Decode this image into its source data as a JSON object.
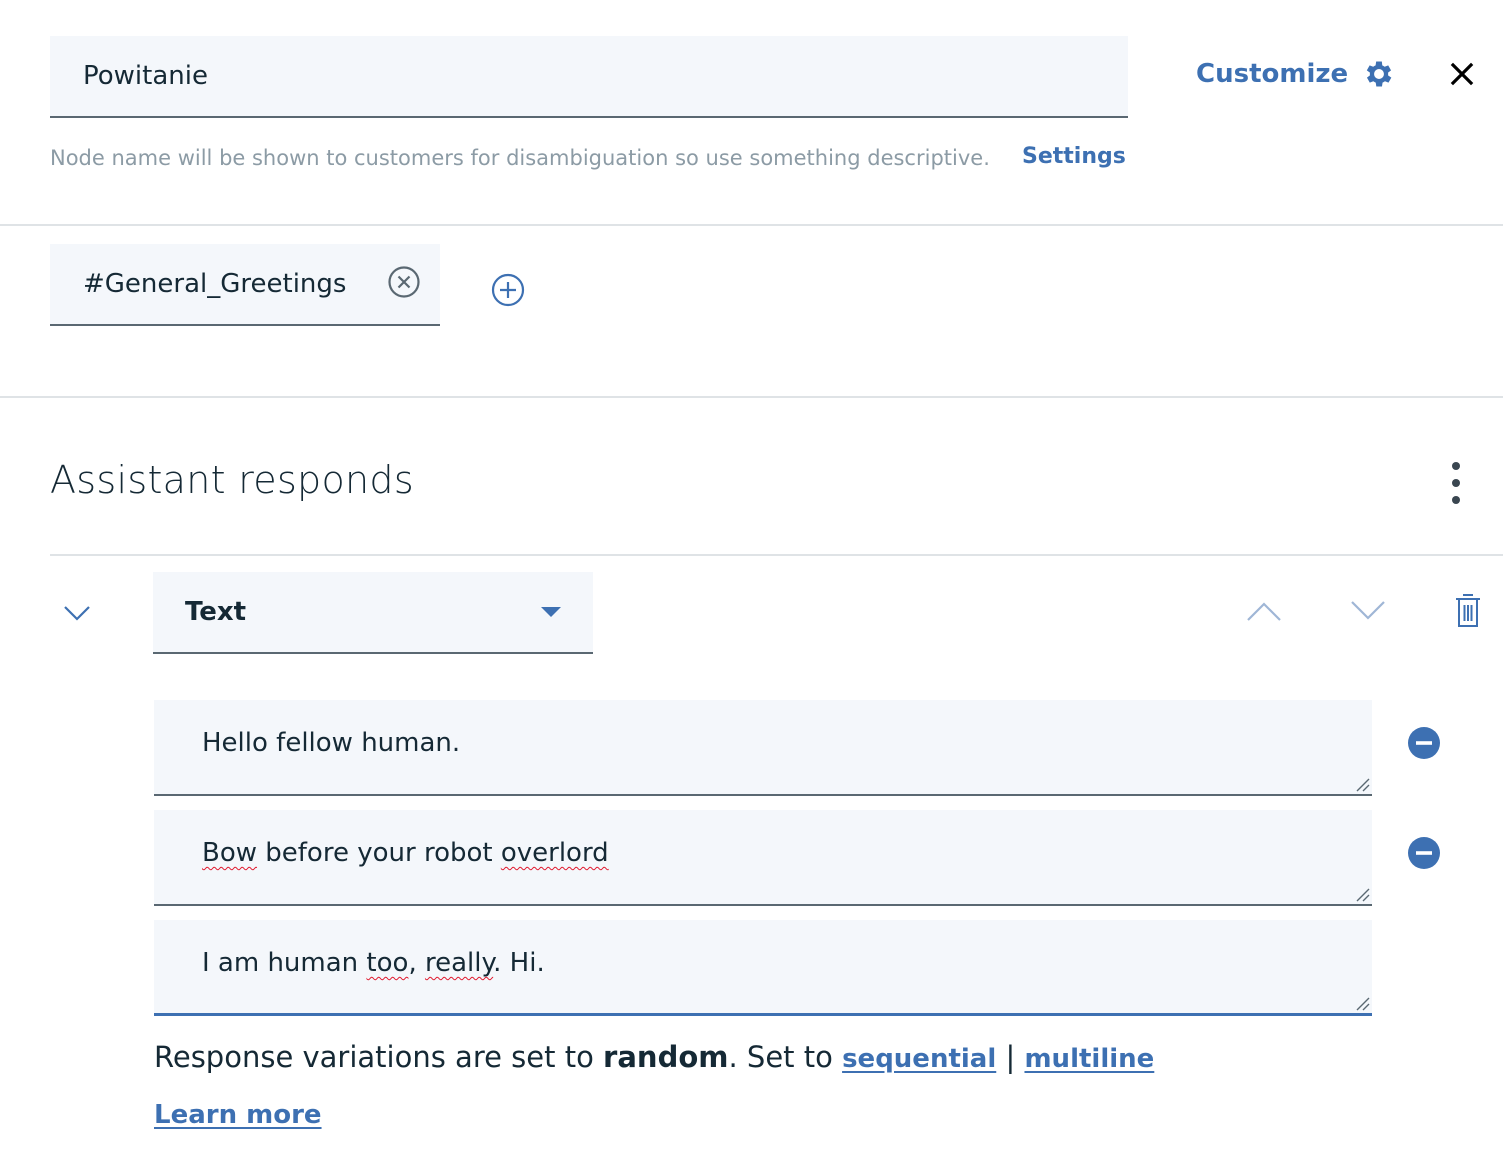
{
  "node": {
    "name_value": "Powitanie",
    "hint": "Node name will be shown to customers for disambiguation so use something descriptive.",
    "settings_label": "Settings",
    "customize_label": "Customize"
  },
  "conditions": {
    "chip_label": "#General_Greetings"
  },
  "responses": {
    "title": "Assistant responds",
    "type_label": "Text",
    "variations": [
      "Hello fellow human.",
      "Bow before your robot overlord",
      "I am human too, really. Hi."
    ],
    "note_prefix": "Response variations are set to ",
    "note_mode": "random",
    "note_middle": ". Set to ",
    "sequential_label": "sequential",
    "separator": "|",
    "multiline_label": "multiline",
    "learn_more_label": "Learn more"
  },
  "colors": {
    "accent": "#3d70b2",
    "field_bg": "#f4f7fb",
    "text": "#152935",
    "muted": "#8c9ba5"
  }
}
